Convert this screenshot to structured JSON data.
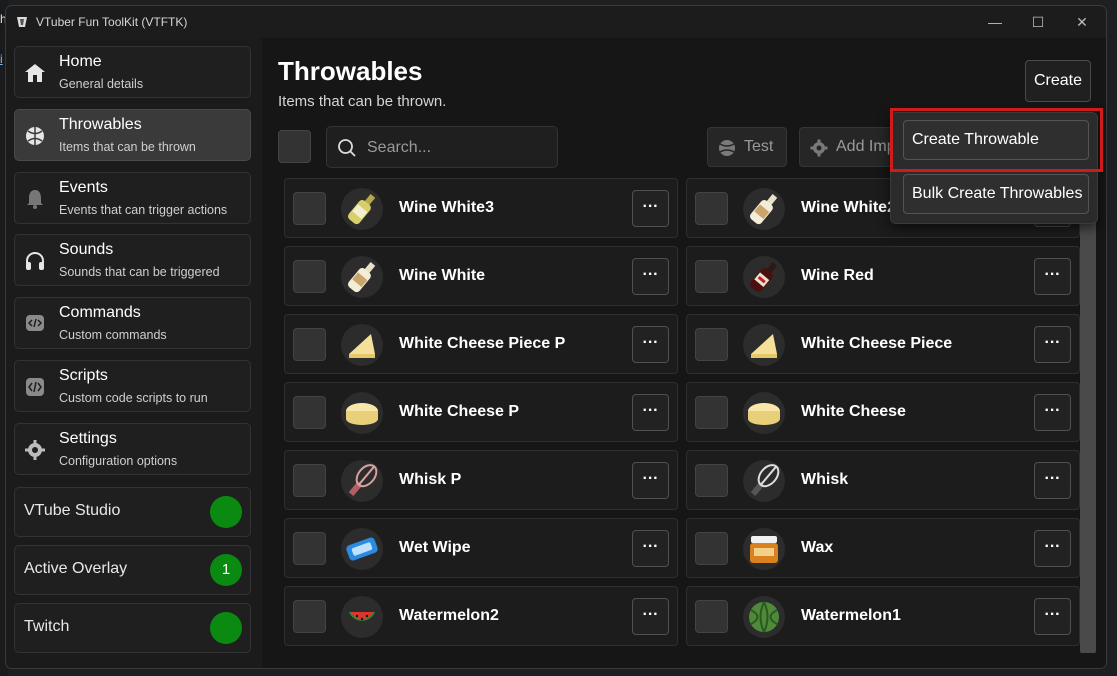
{
  "window": {
    "title": "VTuber Fun ToolKit (VTFTK)"
  },
  "sidebar": {
    "items": [
      {
        "title": "Home",
        "subtitle": "General details",
        "icon": "home-icon"
      },
      {
        "title": "Throwables",
        "subtitle": "Items that can be thrown",
        "icon": "ball-icon",
        "active": true
      },
      {
        "title": "Events",
        "subtitle": "Events that can trigger actions",
        "icon": "bell-icon"
      },
      {
        "title": "Sounds",
        "subtitle": "Sounds that can be triggered",
        "icon": "headphones-icon"
      },
      {
        "title": "Commands",
        "subtitle": "Custom commands",
        "icon": "code-bubble-icon"
      },
      {
        "title": "Scripts",
        "subtitle": "Custom code scripts to run",
        "icon": "code-file-icon"
      },
      {
        "title": "Settings",
        "subtitle": "Configuration options",
        "icon": "gear-icon"
      }
    ],
    "status": [
      {
        "label": "VTube Studio",
        "value": "",
        "color": "#0b8a12"
      },
      {
        "label": "Active Overlay",
        "value": "1",
        "color": "#0b8a12"
      },
      {
        "label": "Twitch",
        "value": "",
        "color": "#0b8a12"
      }
    ]
  },
  "main": {
    "title": "Throwables",
    "subtitle": "Items that can be thrown.",
    "create_label": "Create",
    "search_placeholder": "Search...",
    "test_label": "Test",
    "add_impact_label": "Add Imp",
    "items": [
      {
        "name": "Wine White3",
        "icon": "white-wine-bottle-icon"
      },
      {
        "name": "Wine White2",
        "icon": "white-wine-bottle-icon"
      },
      {
        "name": "Wine White",
        "icon": "white-wine-bottle-icon"
      },
      {
        "name": "Wine Red",
        "icon": "red-wine-bottle-icon"
      },
      {
        "name": "White Cheese Piece P",
        "icon": "cheese-wedge-icon"
      },
      {
        "name": "White Cheese Piece",
        "icon": "cheese-wedge-icon"
      },
      {
        "name": "White Cheese P",
        "icon": "cheese-wheel-icon"
      },
      {
        "name": "White Cheese",
        "icon": "cheese-wheel-icon"
      },
      {
        "name": "Whisk P",
        "icon": "whisk-icon"
      },
      {
        "name": "Whisk",
        "icon": "whisk-icon"
      },
      {
        "name": "Wet Wipe",
        "icon": "wet-wipe-icon"
      },
      {
        "name": "Wax",
        "icon": "wax-jar-icon"
      },
      {
        "name": "Watermelon2",
        "icon": "watermelon-slice-icon"
      },
      {
        "name": "Watermelon1",
        "icon": "watermelon-icon"
      }
    ],
    "menu_label": "···"
  },
  "dropdown": {
    "items": [
      "Create Throwable",
      "Bulk Create Throwables"
    ]
  },
  "edge_text": [
    "h",
    "i"
  ]
}
